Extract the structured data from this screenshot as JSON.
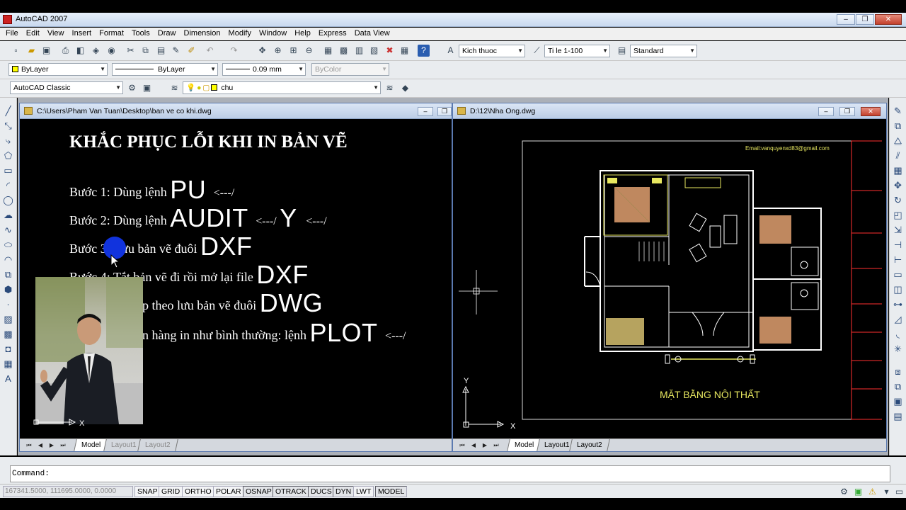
{
  "app": {
    "title": "AutoCAD 2007"
  },
  "menu": [
    "File",
    "Edit",
    "View",
    "Insert",
    "Format",
    "Tools",
    "Draw",
    "Dimension",
    "Modify",
    "Window",
    "Help",
    "Express",
    "Data View"
  ],
  "toolbar": {
    "dimstyle": "Kich thuoc",
    "scale": "Ti le 1-100",
    "textstyle": "Standard",
    "color": "ByLayer",
    "linetype": "ByLayer",
    "lineweight": "0.09 mm",
    "plotstyle": "ByColor",
    "workspace": "AutoCAD Classic",
    "layer": "chu"
  },
  "doc_left": {
    "title": "C:\\Users\\Pham Van Tuan\\Desktop\\ban ve co khi.dwg",
    "heading": "KHẮC PHỤC LỖI KHI IN BẢN VẼ",
    "steps": [
      {
        "prefix": "Bước 1: Dùng lệnh",
        "cmd": "PU",
        "suffix": "<---/"
      },
      {
        "prefix": "Bước 2: Dùng lệnh",
        "cmd": "AUDIT",
        "suffix": "<---/",
        "cmd2": "Y",
        "suffix2": "<---/"
      },
      {
        "prefix": "Bước 3: Lưu bản vẽ đuôi",
        "cmd": "DXF"
      },
      {
        "prefix": "Bước 4: Tắt bản vẽ đi rồi mở lại file",
        "cmd": "DXF"
      },
      {
        "prefix": "p theo lưu bản vẽ  đuôi",
        "cmd": "DWG"
      },
      {
        "prefix": "n hàng in như bình thường: lệnh",
        "cmd": "PLOT",
        "suffix": "<---/"
      }
    ],
    "tabs": [
      "Model",
      "Layout1",
      "Layout2"
    ]
  },
  "doc_right": {
    "title": "D:\\12\\Nha Ong.dwg",
    "email": "Email:vanquyenxd83@gmail.com",
    "plan_title": "MẶT BẰNG NỘI THẤT",
    "tabs": [
      "Model",
      "Layout1",
      "Layout2"
    ]
  },
  "command": {
    "label": "Command:"
  },
  "status": {
    "coords": "167341.5000, 111695.0000, 0.0000",
    "buttons": [
      "SNAP",
      "GRID",
      "ORTHO",
      "POLAR",
      "OSNAP",
      "OTRACK",
      "DUCS",
      "DYN",
      "LWT",
      "MODEL"
    ]
  },
  "colors": {
    "plan_lines": "#ffffff",
    "plan_walls": "#e8e860",
    "room_fill": "#e0a070",
    "border_red": "#ff3030",
    "cursor_blue": "#1133dd"
  }
}
